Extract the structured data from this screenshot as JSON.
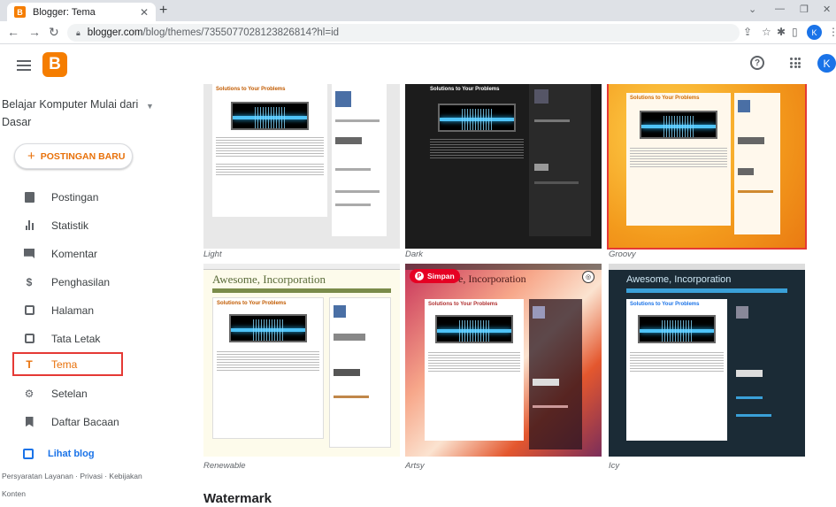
{
  "browser": {
    "tab_title": "Blogger: Tema",
    "url_host": "blogger.com",
    "url_path": "/blog/themes/7355077028123826814?hl=id",
    "profile_initial": "K"
  },
  "app": {
    "logo_letter": "B",
    "help_glyph": "?",
    "avatar_initial": "K"
  },
  "sidebar": {
    "blog_name": "Belajar Komputer Mulai dari Dasar",
    "new_post_label": "POSTINGAN BARU",
    "items": [
      {
        "label": "Postingan",
        "icon": "posts-icon"
      },
      {
        "label": "Statistik",
        "icon": "stats-icon"
      },
      {
        "label": "Komentar",
        "icon": "comments-icon"
      },
      {
        "label": "Penghasilan",
        "icon": "earnings-icon"
      },
      {
        "label": "Halaman",
        "icon": "pages-icon"
      },
      {
        "label": "Tata Letak",
        "icon": "layout-icon"
      },
      {
        "label": "Tema",
        "icon": "theme-icon",
        "active": true
      },
      {
        "label": "Setelan",
        "icon": "settings-icon"
      },
      {
        "label": "Daftar Bacaan",
        "icon": "reading-list-icon"
      }
    ],
    "view_blog_label": "Lihat blog",
    "footer_links": "Persyaratan Layanan · Privasi · Kebijakan Konten"
  },
  "themes": {
    "cards": [
      {
        "label": "Light",
        "preview_title": "Solutions to Your Problems"
      },
      {
        "label": "Dark",
        "preview_title": "Solutions to Your Problems"
      },
      {
        "label": "Groovy",
        "preview_title": "Solutions to Your Problems",
        "selected": true
      },
      {
        "label": "Renewable",
        "header": "Awesome, Incorporation",
        "preview_title": "Solutions to Your Problems"
      },
      {
        "label": "Artsy",
        "header": "e, Incorporation",
        "preview_title": "Solutions to Your Problems"
      },
      {
        "label": "Icy",
        "header": "Awesome, Incorporation",
        "preview_title": "Solutions to Your Problems"
      }
    ],
    "pin_label": "Simpan",
    "section_title": "Watermark"
  },
  "colors": {
    "accent_orange": "#e8710a",
    "selection_red": "#e53935",
    "blogger_orange": "#f57d00"
  }
}
